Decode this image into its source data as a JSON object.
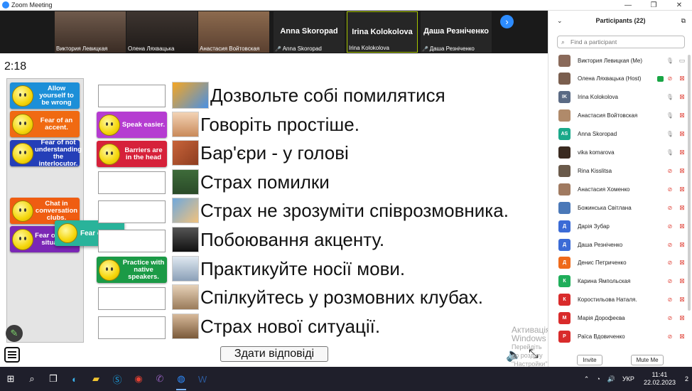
{
  "window": {
    "title": "Zoom Meeting",
    "ctrl_min": "—",
    "ctrl_max": "❐",
    "ctrl_close": "✕"
  },
  "video_tiles": [
    {
      "name": "Виктория Левицкая",
      "big": ""
    },
    {
      "name": "Олена Ляхвацька",
      "big": ""
    },
    {
      "name": "Анастасия Войтовская",
      "big": ""
    },
    {
      "name": "Anna Skoropad",
      "big": "Anna Skoropad"
    },
    {
      "name": "Irina Kolokolova",
      "big": "Irina Kolokolova"
    },
    {
      "name": "Даша Резніченко",
      "big": "Даша Резніченко"
    }
  ],
  "next_glyph": "›",
  "timer": "2:18",
  "left_cards": [
    {
      "label": "Allow yourself to be wrong",
      "color": "#1c8fd8"
    },
    {
      "label": "Fear of an accent.",
      "color": "#f06a12"
    },
    {
      "label": "Fear of not understanding the interlocutor.",
      "color": "#243fb8"
    },
    {
      "label": "Chat in conversation clubs.",
      "color": "#ef5d12"
    },
    {
      "label": "Fear of a new situation.",
      "color": "#7b27b5"
    }
  ],
  "drag_card": {
    "label": "Fear of error",
    "color": "#29b39a"
  },
  "slot_cards": [
    {
      "label": "Speak easier.",
      "color": "#b53cd1"
    },
    {
      "label": "Barriers are in the head",
      "color": "#d6213a"
    },
    {
      "label": "Practice with native speakers.",
      "color": "#1b9a46"
    }
  ],
  "phrases": [
    "Дозвольте собі помилятися",
    "Говоріть простіше.",
    "Бар'єри - у голові",
    "Страх помилки",
    "Страх не зрозуміти співрозмовника.",
    "Побоювання акценту.",
    "Практикуйте носії мови.",
    "Спілкуйтесь у розмовних клубах.",
    "Страх нової ситуації."
  ],
  "submit_label": "Здати відповіді",
  "watermark": {
    "line1": "Активація Windows",
    "line2": "Перейдіть до розділу \"Настройки\", щоб активувати"
  },
  "participants": {
    "title": "Participants (22)",
    "search_placeholder": "Find a participant",
    "list": [
      {
        "name": "Виктория Левицкая (Me)",
        "initials": "",
        "color": "#8a6a5a",
        "mic": "on",
        "cam": "on",
        "host": false
      },
      {
        "name": "Олена Ляхвацька (Host)",
        "initials": "",
        "color": "#7a5e4e",
        "mic": "off",
        "cam": "off",
        "host": true
      },
      {
        "name": "Irina Kolokolova",
        "initials": "IK",
        "color": "#5a6a84",
        "mic": "on",
        "cam": "off",
        "host": false
      },
      {
        "name": "Анастасия Войтовская",
        "initials": "",
        "color": "#b08a6a",
        "mic": "on",
        "cam": "off",
        "host": false
      },
      {
        "name": "Anna Skoropad",
        "initials": "AS",
        "color": "#1aa98a",
        "mic": "on",
        "cam": "off",
        "host": false
      },
      {
        "name": "vika komarova",
        "initials": "",
        "color": "#3a2a20",
        "mic": "on",
        "cam": "off",
        "host": false
      },
      {
        "name": "Rina Kisslitsa",
        "initials": "",
        "color": "#6a5a4a",
        "mic": "off",
        "cam": "off",
        "host": false
      },
      {
        "name": "Анастасия Хоменко",
        "initials": "",
        "color": "#a07a60",
        "mic": "off",
        "cam": "off",
        "host": false
      },
      {
        "name": "Божинська Світлана",
        "initials": "",
        "color": "#4a78b8",
        "mic": "off",
        "cam": "off",
        "host": false
      },
      {
        "name": "Дарія Зубар",
        "initials": "Д",
        "color": "#3b6bd6",
        "mic": "off",
        "cam": "off",
        "host": false
      },
      {
        "name": "Даша Резніченко",
        "initials": "Д",
        "color": "#3b6bd6",
        "mic": "off",
        "cam": "off",
        "host": false
      },
      {
        "name": "Денис Петриченко",
        "initials": "Д",
        "color": "#ef6a1b",
        "mic": "off",
        "cam": "off",
        "host": false
      },
      {
        "name": "Карина Ямпольская",
        "initials": "К",
        "color": "#1fae5a",
        "mic": "off",
        "cam": "off",
        "host": false
      },
      {
        "name": "Коростильова Наталя.",
        "initials": "К",
        "color": "#d92b2b",
        "mic": "off",
        "cam": "off",
        "host": false
      },
      {
        "name": "Марія Дорофеєва",
        "initials": "М",
        "color": "#d92b2b",
        "mic": "off",
        "cam": "off",
        "host": false
      },
      {
        "name": "Раїса Вдовиченко",
        "initials": "Р",
        "color": "#d92b2b",
        "mic": "off",
        "cam": "off",
        "host": false
      }
    ],
    "invite_label": "Invite",
    "mute_label": "Mute Me"
  },
  "taskbar": {
    "time": "11:41",
    "date": "22.02.2023",
    "lang": "УКР",
    "notif": "2"
  }
}
